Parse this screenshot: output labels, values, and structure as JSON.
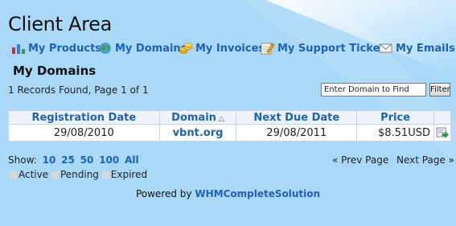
{
  "header": {
    "title": "Client Area"
  },
  "nav": [
    {
      "label": "My Products",
      "icon": "bar-chart-icon"
    },
    {
      "label": "My Domains",
      "icon": "globe-icon"
    },
    {
      "label": "My Invoices",
      "icon": "coins-icon"
    },
    {
      "label": "My Support Tickets",
      "icon": "pencil-note-icon"
    },
    {
      "label": "My Emails",
      "icon": "envelope-icon"
    }
  ],
  "section": {
    "title": "My Domains",
    "records_info": "1 Records Found, Page 1 of 1"
  },
  "search": {
    "value": "Enter Domain to Find",
    "button": "Filter"
  },
  "table": {
    "headers": [
      "Registration Date",
      "Domain",
      "Next Due Date",
      "Price"
    ],
    "sort_indicator": "△",
    "rows": [
      {
        "registration_date": "29/08/2010",
        "domain": "vbnt.org",
        "next_due_date": "29/08/2011",
        "price": "$8.51USD"
      }
    ]
  },
  "pagination": {
    "show_label": "Show:",
    "page_sizes": [
      "10",
      "25",
      "50",
      "100",
      "All"
    ],
    "prev": "« Prev Page",
    "next": "Next Page »"
  },
  "legend": [
    "Active",
    "Pending",
    "Expired"
  ],
  "footer": {
    "prefix": "Powered by",
    "link": "WHMCompleteSolution"
  },
  "colors": {
    "background": "#a9d8f9",
    "link": "#1e62b4"
  }
}
